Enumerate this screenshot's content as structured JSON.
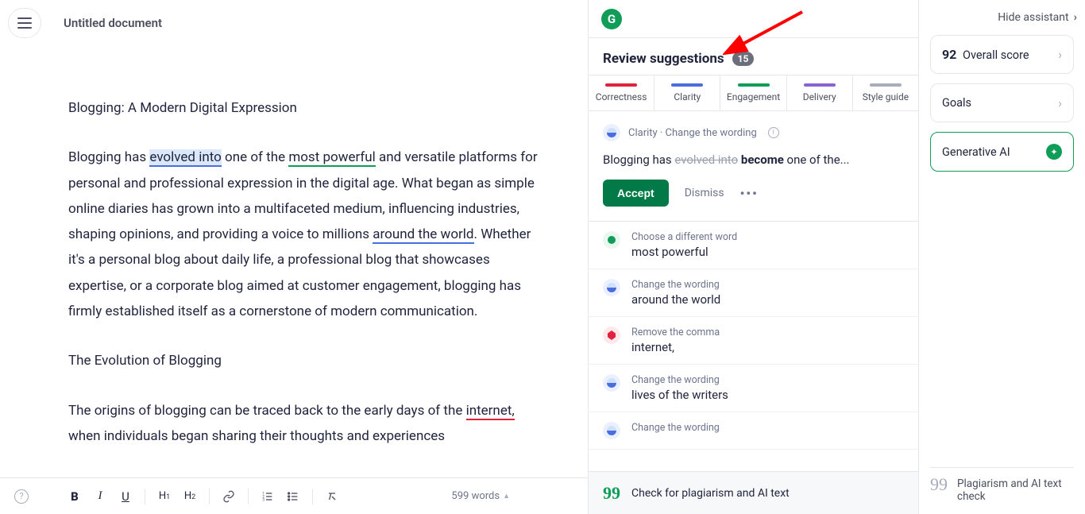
{
  "header": {
    "doc_title": "Untitled document"
  },
  "document": {
    "heading": "Blogging: A Modern Digital Expression",
    "p1_a": "Blogging has ",
    "p1_evolved": "evolved into",
    "p1_b": " one of the ",
    "p1_powerful": "most powerful",
    "p1_c": " and versatile platforms for personal and professional expression in the digital age. What began as simple online diaries has grown into a multifaceted medium, influencing industries, shaping opinions, and providing a voice to millions ",
    "p1_world": "around the world",
    "p1_d": ". Whether it's a personal blog about daily life, a professional blog that showcases expertise, or a corporate blog aimed at customer engagement, blogging has firmly established itself as a cornerstone of modern communication.",
    "h2": "The Evolution of Blogging",
    "p2_a": "The origins of blogging can be traced back to the early days of the ",
    "p2_internet": "internet,",
    "p2_b": " when individuals began sharing their thoughts and experiences"
  },
  "footer": {
    "word_count": "599 words"
  },
  "suggestions": {
    "title": "Review suggestions",
    "count": "15",
    "categories": {
      "correctness": "Correctness",
      "clarity": "Clarity",
      "engagement": "Engagement",
      "delivery": "Delivery",
      "style": "Style guide"
    },
    "active": {
      "cat_label": "Clarity · Change the wording",
      "prefix": "Blogging has ",
      "strike": "evolved into",
      "replace": "become",
      "suffix": " one of the...",
      "accept": "Accept",
      "dismiss": "Dismiss"
    },
    "cards": [
      {
        "cat": "Choose a different word",
        "text": "most powerful",
        "dot": "dot-engage"
      },
      {
        "cat": "Change the wording",
        "text": "around the world",
        "dot": "dot-blue2"
      },
      {
        "cat": "Remove the comma",
        "text": "internet,",
        "dot": "dot-red2"
      },
      {
        "cat": "Change the wording",
        "text": "lives of the writers",
        "dot": "dot-blue2"
      },
      {
        "cat": "Change the wording",
        "text": "",
        "dot": "dot-blue2"
      }
    ],
    "footer_text": "Check for plagiarism and AI text"
  },
  "assistant": {
    "hide": "Hide assistant",
    "score_num": "92",
    "score_label": "Overall score",
    "goals": "Goals",
    "gen": "Generative AI",
    "plag": "Plagiarism and AI text check"
  }
}
